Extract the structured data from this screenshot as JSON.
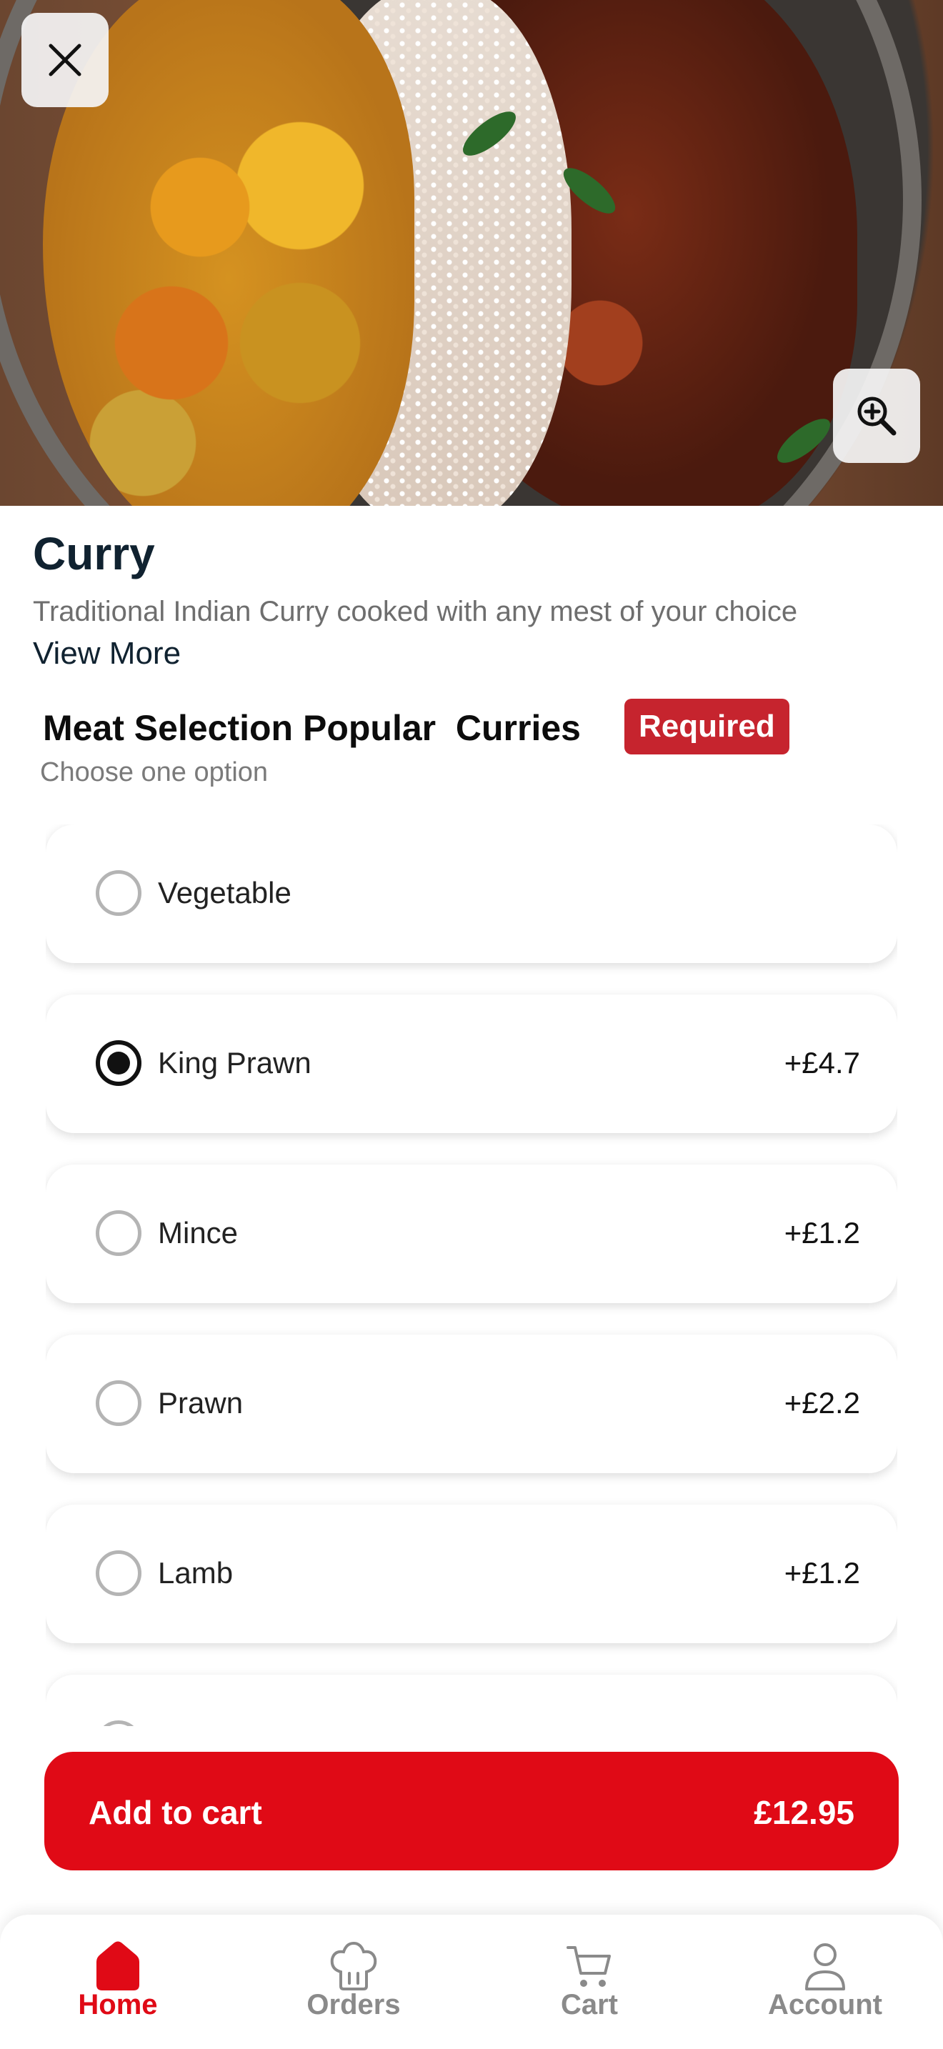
{
  "product": {
    "title": "Curry",
    "description": "Traditional Indian Curry cooked with any mest of your choice",
    "view_more": "View More"
  },
  "hero": {
    "close_icon": "close-icon",
    "zoom_icon": "zoom-in-icon"
  },
  "section": {
    "title": "Meat Selection Popular  Curries",
    "badge": "Required",
    "subtitle": "Choose one option",
    "options": [
      {
        "label": "Vegetable",
        "price": "",
        "selected": false
      },
      {
        "label": "King Prawn",
        "price": "+£4.7",
        "selected": true
      },
      {
        "label": "Mince",
        "price": "+£1.2",
        "selected": false
      },
      {
        "label": "Prawn",
        "price": "+£2.2",
        "selected": false
      },
      {
        "label": "Lamb",
        "price": "+£1.2",
        "selected": false
      }
    ]
  },
  "cart_button": {
    "label": "Add to cart",
    "price": "£12.95"
  },
  "tabbar": {
    "items": [
      {
        "label": "Home",
        "icon": "home-icon",
        "active": true
      },
      {
        "label": "Orders",
        "icon": "chef-hat-icon",
        "active": false
      },
      {
        "label": "Cart",
        "icon": "cart-icon",
        "active": false
      },
      {
        "label": "Account",
        "icon": "user-icon",
        "active": false
      }
    ]
  },
  "colors": {
    "accent_red": "#e00a16",
    "badge_red": "#c6242e",
    "title_dark": "#102230"
  }
}
